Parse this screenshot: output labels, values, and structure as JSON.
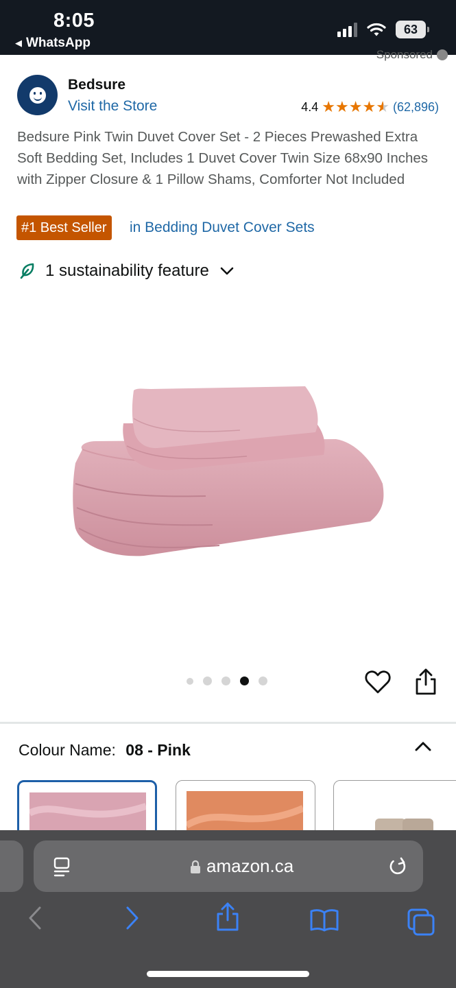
{
  "status_bar": {
    "time": "8:05",
    "back_app": "WhatsApp",
    "battery": "63"
  },
  "sponsored": "Sponsored",
  "brand": {
    "name": "Bedsure",
    "visit_store": "Visit the Store",
    "rating": "4.4",
    "rating_stars": 4.4,
    "rating_count": "(62,896)"
  },
  "product": {
    "title": "Bedsure Pink Twin Duvet Cover Set - 2 Pieces Prewashed Extra Soft Bedding Set, Includes 1 Duvet Cover Twin Size 68x90 Inches with Zipper Closure & 1 Pillow Shams, Comforter Not Included",
    "best_seller_badge": "#1 Best Seller",
    "best_seller_category": "in Bedding Duvet Cover Sets",
    "sustainability": "1 sustainability feature",
    "image_color": "#dba2ad"
  },
  "carousel": {
    "count": 5,
    "active_index": 3
  },
  "colour": {
    "label": "Colour Name:",
    "value": "08 - Pink",
    "swatches": [
      {
        "name": "Pink",
        "color": "#d9a4b2",
        "selected": true
      },
      {
        "name": "Orange",
        "color": "#e08a60",
        "selected": false
      },
      {
        "name": "Taupe",
        "color": "#c4b4a4",
        "selected": false
      }
    ]
  },
  "browser": {
    "url": "amazon.ca"
  },
  "colors": {
    "link": "#1f68a6",
    "star": "#e77600",
    "badge": "#c45500",
    "header": "#131921",
    "toolbar_icon": "#3b82f6"
  }
}
